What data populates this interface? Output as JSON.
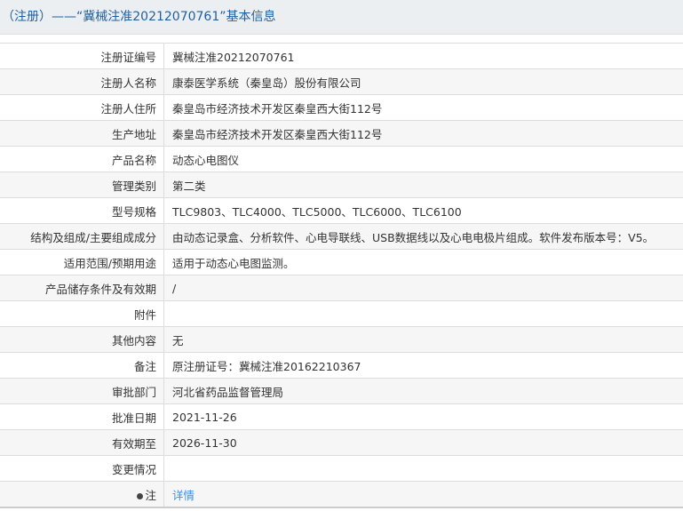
{
  "header": {
    "title": "（注册）——“冀械注准20212070761”基本信息"
  },
  "rows": [
    {
      "label": "注册证编号",
      "value": "冀械注准20212070761"
    },
    {
      "label": "注册人名称",
      "value": "康泰医学系统（秦皇岛）股份有限公司"
    },
    {
      "label": "注册人住所",
      "value": "秦皇岛市经济技术开发区秦皇西大街112号"
    },
    {
      "label": "生产地址",
      "value": "秦皇岛市经济技术开发区秦皇西大街112号"
    },
    {
      "label": "产品名称",
      "value": "动态心电图仪"
    },
    {
      "label": "管理类别",
      "value": "第二类"
    },
    {
      "label": "型号规格",
      "value": "TLC9803、TLC4000、TLC5000、TLC6000、TLC6100"
    },
    {
      "label": "结构及组成/主要组成成分",
      "value": "由动态记录盒、分析软件、心电导联线、USB数据线以及心电电极片组成。软件发布版本号：V5。"
    },
    {
      "label": "适用范围/预期用途",
      "value": "适用于动态心电图监测。"
    },
    {
      "label": "产品储存条件及有效期",
      "value": "/"
    },
    {
      "label": "附件",
      "value": ""
    },
    {
      "label": "其他内容",
      "value": "无"
    },
    {
      "label": "备注",
      "value": "原注册证号：冀械注准20162210367"
    },
    {
      "label": "审批部门",
      "value": "河北省药品监督管理局"
    },
    {
      "label": "批准日期",
      "value": "2021-11-26"
    },
    {
      "label": "有效期至",
      "value": "2026-11-30"
    },
    {
      "label": "变更情况",
      "value": ""
    }
  ],
  "note": {
    "label": "注",
    "link": "详情"
  }
}
